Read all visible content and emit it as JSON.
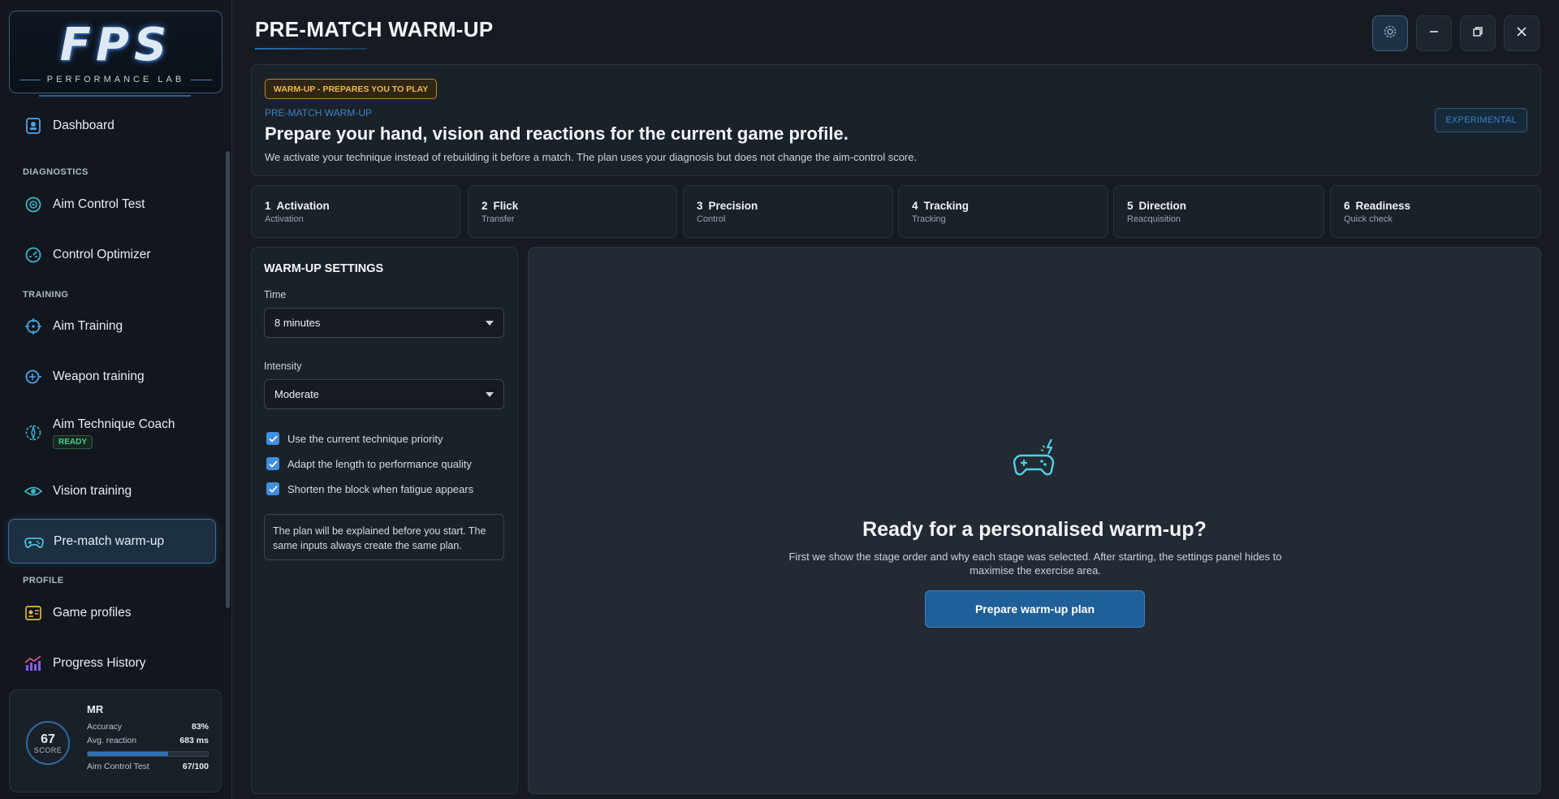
{
  "app": {
    "logo_main": "FPS",
    "logo_sub": "PERFORMANCE LAB"
  },
  "sidebar": {
    "dashboard": "Dashboard",
    "sections": {
      "diagnostics": "DIAGNOSTICS",
      "training": "TRAINING",
      "profile": "PROFILE"
    },
    "items": {
      "aim_control_test": "Aim Control Test",
      "control_optimizer": "Control Optimizer",
      "aim_training": "Aim Training",
      "weapon_training": "Weapon training",
      "aim_technique_coach": "Aim Technique Coach",
      "aim_technique_coach_badge": "READY",
      "vision_training": "Vision training",
      "pre_match_warmup": "Pre-match warm-up",
      "game_profiles": "Game profiles",
      "progress_history": "Progress History"
    }
  },
  "profile_card": {
    "score": "67",
    "score_label": "SCORE",
    "name": "MR",
    "accuracy_label": "Accuracy",
    "accuracy_value": "83%",
    "reaction_label": "Avg. reaction",
    "reaction_value": "683 ms",
    "test_label": "Aim Control Test",
    "test_value": "67/100",
    "test_progress": 0.67
  },
  "header": {
    "title": "PRE-MATCH WARM-UP"
  },
  "intro": {
    "badge": "WARM-UP - PREPARES YOU TO PLAY",
    "kicker": "PRE-MATCH WARM-UP",
    "heading": "Prepare your hand, vision and reactions for the current game profile.",
    "description": "We activate your technique instead of rebuilding it before a match. The plan uses your diagnosis but does not change the aim-control score.",
    "experimental": "EXPERIMENTAL"
  },
  "steps": [
    {
      "num": "1",
      "title": "Activation",
      "sub": "Activation"
    },
    {
      "num": "2",
      "title": "Flick",
      "sub": "Transfer"
    },
    {
      "num": "3",
      "title": "Precision",
      "sub": "Control"
    },
    {
      "num": "4",
      "title": "Tracking",
      "sub": "Tracking"
    },
    {
      "num": "5",
      "title": "Direction",
      "sub": "Reacquisition"
    },
    {
      "num": "6",
      "title": "Readiness",
      "sub": "Quick check"
    }
  ],
  "settings": {
    "title": "WARM-UP SETTINGS",
    "time_label": "Time",
    "time_value": "8 minutes",
    "intensity_label": "Intensity",
    "intensity_value": "Moderate",
    "checks": [
      {
        "label": "Use the current technique priority",
        "checked": true
      },
      {
        "label": "Adapt the length to performance quality",
        "checked": true
      },
      {
        "label": "Shorten the block when fatigue appears",
        "checked": true
      }
    ],
    "note": "The plan will be explained before you start. The same inputs always create the same plan."
  },
  "stage": {
    "icon": "gamepad-lightning-icon",
    "heading": "Ready for a personalised warm-up?",
    "description": "First we show the stage order and why each stage was selected. After starting, the settings panel hides to maximise the exercise area.",
    "button": "Prepare warm-up plan"
  },
  "colors": {
    "accent": "#3f8ee0",
    "warning": "#f0b94a",
    "success": "#3fcf8e"
  }
}
